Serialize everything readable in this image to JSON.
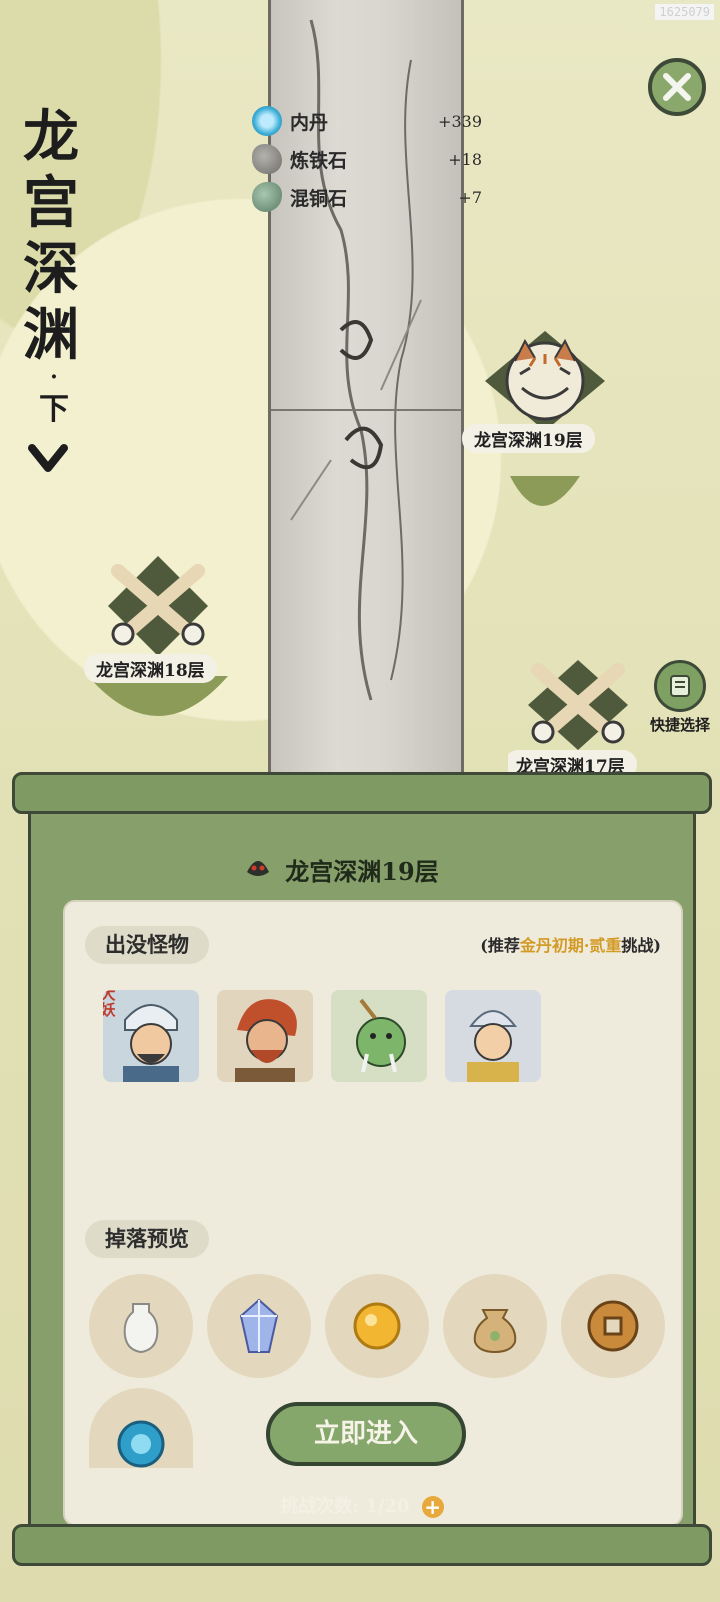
{
  "watermark": "1625079",
  "title": {
    "chars": [
      "龙",
      "宫",
      "深",
      "渊"
    ],
    "dot": "·",
    "sub": "下"
  },
  "resources": [
    {
      "name": "内丹",
      "count": "+339",
      "color": "#3fb0d8"
    },
    {
      "name": "炼铁石",
      "count": "+18",
      "color": "#8b8a86"
    },
    {
      "name": "混铜石",
      "count": "+7",
      "color": "#7a9b83"
    }
  ],
  "nodes": [
    {
      "label": "龙宫深渊19层",
      "type": "boss"
    },
    {
      "label": "龙宫深渊18层",
      "type": "battle"
    },
    {
      "label": "龙宫深渊17层",
      "type": "battle"
    }
  ],
  "quick_select": "快捷选择",
  "panel": {
    "title": "龙宫深渊19层",
    "monsters_title": "出没怪物",
    "recommend": {
      "prefix": "(推荐",
      "highlight": "金丹初期·贰重",
      "suffix": "挑战)"
    },
    "boss_badge": "大妖",
    "monsters": [
      "general-silver-helmet",
      "red-hair-warrior",
      "green-fish-demon",
      "golden-armor-guard"
    ],
    "drops_title": "掉落预览",
    "drops": [
      "vase-icon",
      "crystal-icon",
      "golden-orb-icon",
      "seed-bag-icon",
      "coin-icon",
      "inner-pill-icon"
    ],
    "enter_button": "立即进入",
    "challenge_label": "挑战次数:",
    "challenge_count": "1/20",
    "plus": "+"
  },
  "colors": {
    "accent_green": "#86a76b",
    "highlight_orange": "#d39a26",
    "frame_dark": "#3e4a37"
  }
}
